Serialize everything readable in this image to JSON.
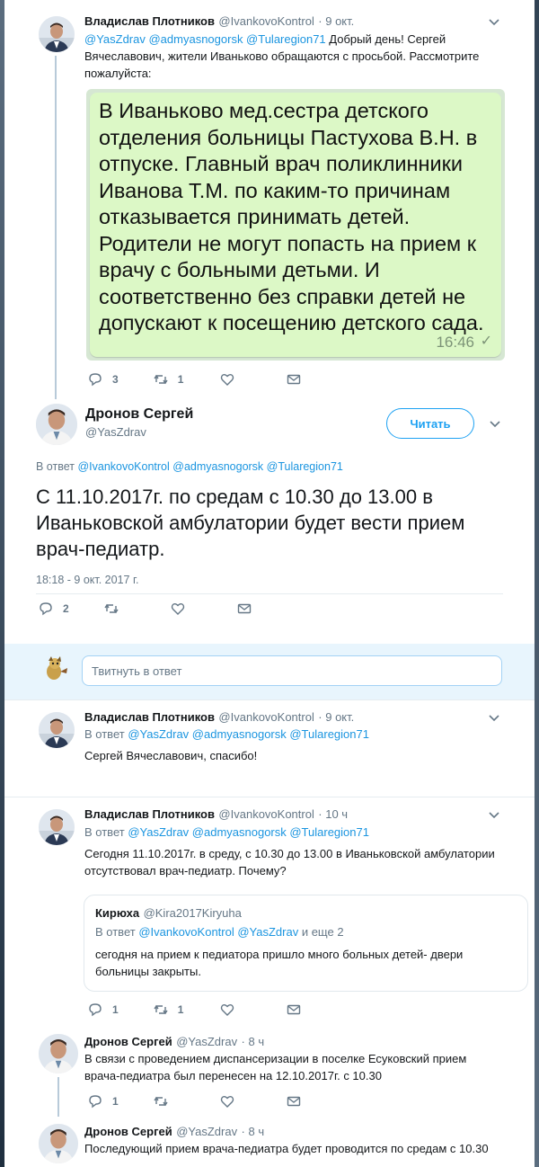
{
  "colors": {
    "link": "#1b95e0",
    "accent": "#1da1f2",
    "muted": "#657786",
    "bubble": "#dcf8c6"
  },
  "tweet1": {
    "name": "Владислав Плотников",
    "handle": "@IvankovoKontrol",
    "date": "· 9 окт.",
    "mentions": "@YasZdrav @admyasnogorsk @Tularegion71",
    "text_line1": " Добрый день! Сергей",
    "text_line2": "Вячеславович, жители Иваньково обращаются с просьбой. Рассмотрите",
    "text_line3": "пожалуйста:",
    "image": {
      "message": "В Иваньково мед.сестра детского отделения больницы Пастухова В.Н. в отпуске. Главный врач поликлинники Иванова Т.М. по каким-то причинам отказывается принимать детей. Родители не могут попасть на прием к врачу с больными детьми. И соответственно без справки детей не допускают к посещению детского сада.",
      "time": "16:46",
      "check": "✓"
    },
    "replies": "3",
    "retweets": "1"
  },
  "main": {
    "name": "Дронов Сергей",
    "handle": "@YasZdrav",
    "follow_label": "Читать",
    "reply_to_prefix": "В ответ ",
    "reply_to_handles": "@IvankovoKontrol @admyasnogorsk @Tularegion71",
    "text": "С 11.10.2017г. по средам с 10.30 до 13.00 в Иваньковской амбулатории будет вести прием врач-педиатр.",
    "timestamp": "18:18 - 9 окт. 2017 г.",
    "replies": "2"
  },
  "compose": {
    "placeholder": "Твитнуть в ответ"
  },
  "reply1": {
    "name": "Владислав Плотников",
    "handle": "@IvankovoKontrol",
    "date": "· 9 окт.",
    "reply_to_prefix": "В ответ ",
    "reply_to_handles": "@YasZdrav @admyasnogorsk @Tularegion71",
    "text": "Сергей Вячеславович, спасибо!"
  },
  "reply2": {
    "name": "Владислав Плотников",
    "handle": "@IvankovoKontrol",
    "date": "· 10 ч",
    "reply_to_prefix": "В ответ ",
    "reply_to_handles": "@YasZdrav @admyasnogorsk @Tularegion71",
    "text_line1": "Сегодня 11.10.2017г. в среду, с 10.30 до 13.00 в Иваньковской амбулатории",
    "text_line2": "отсутствовал врач-педиатр. Почему?",
    "quote": {
      "name": "Кирюха",
      "handle": "@Kira2017Kiryuha",
      "reply_to_prefix": "В ответ ",
      "reply_to_handles": "@IvankovoKontrol @YasZdrav",
      "reply_to_suffix": " и еще 2",
      "text_line1": "сегодня на прием к педиатора пришло много больных детей- двери",
      "text_line2": "больницы закрыты."
    },
    "replies": "1",
    "retweets": "1"
  },
  "reply3": {
    "name": "Дронов Сергей",
    "handle": "@YasZdrav",
    "date": "· 8 ч",
    "text_line1": "В связи с проведением диспансеризации в поселке Есуковский прием",
    "text_line2": "врача-педиатра был перенесен на 12.10.2017г. с 10.30",
    "replies": "1"
  },
  "reply4": {
    "name": "Дронов Сергей",
    "handle": "@YasZdrav",
    "date": "· 8 ч",
    "text_line1": "Последующий прием врача-педиатра будет проводится по средам с 10.30"
  }
}
